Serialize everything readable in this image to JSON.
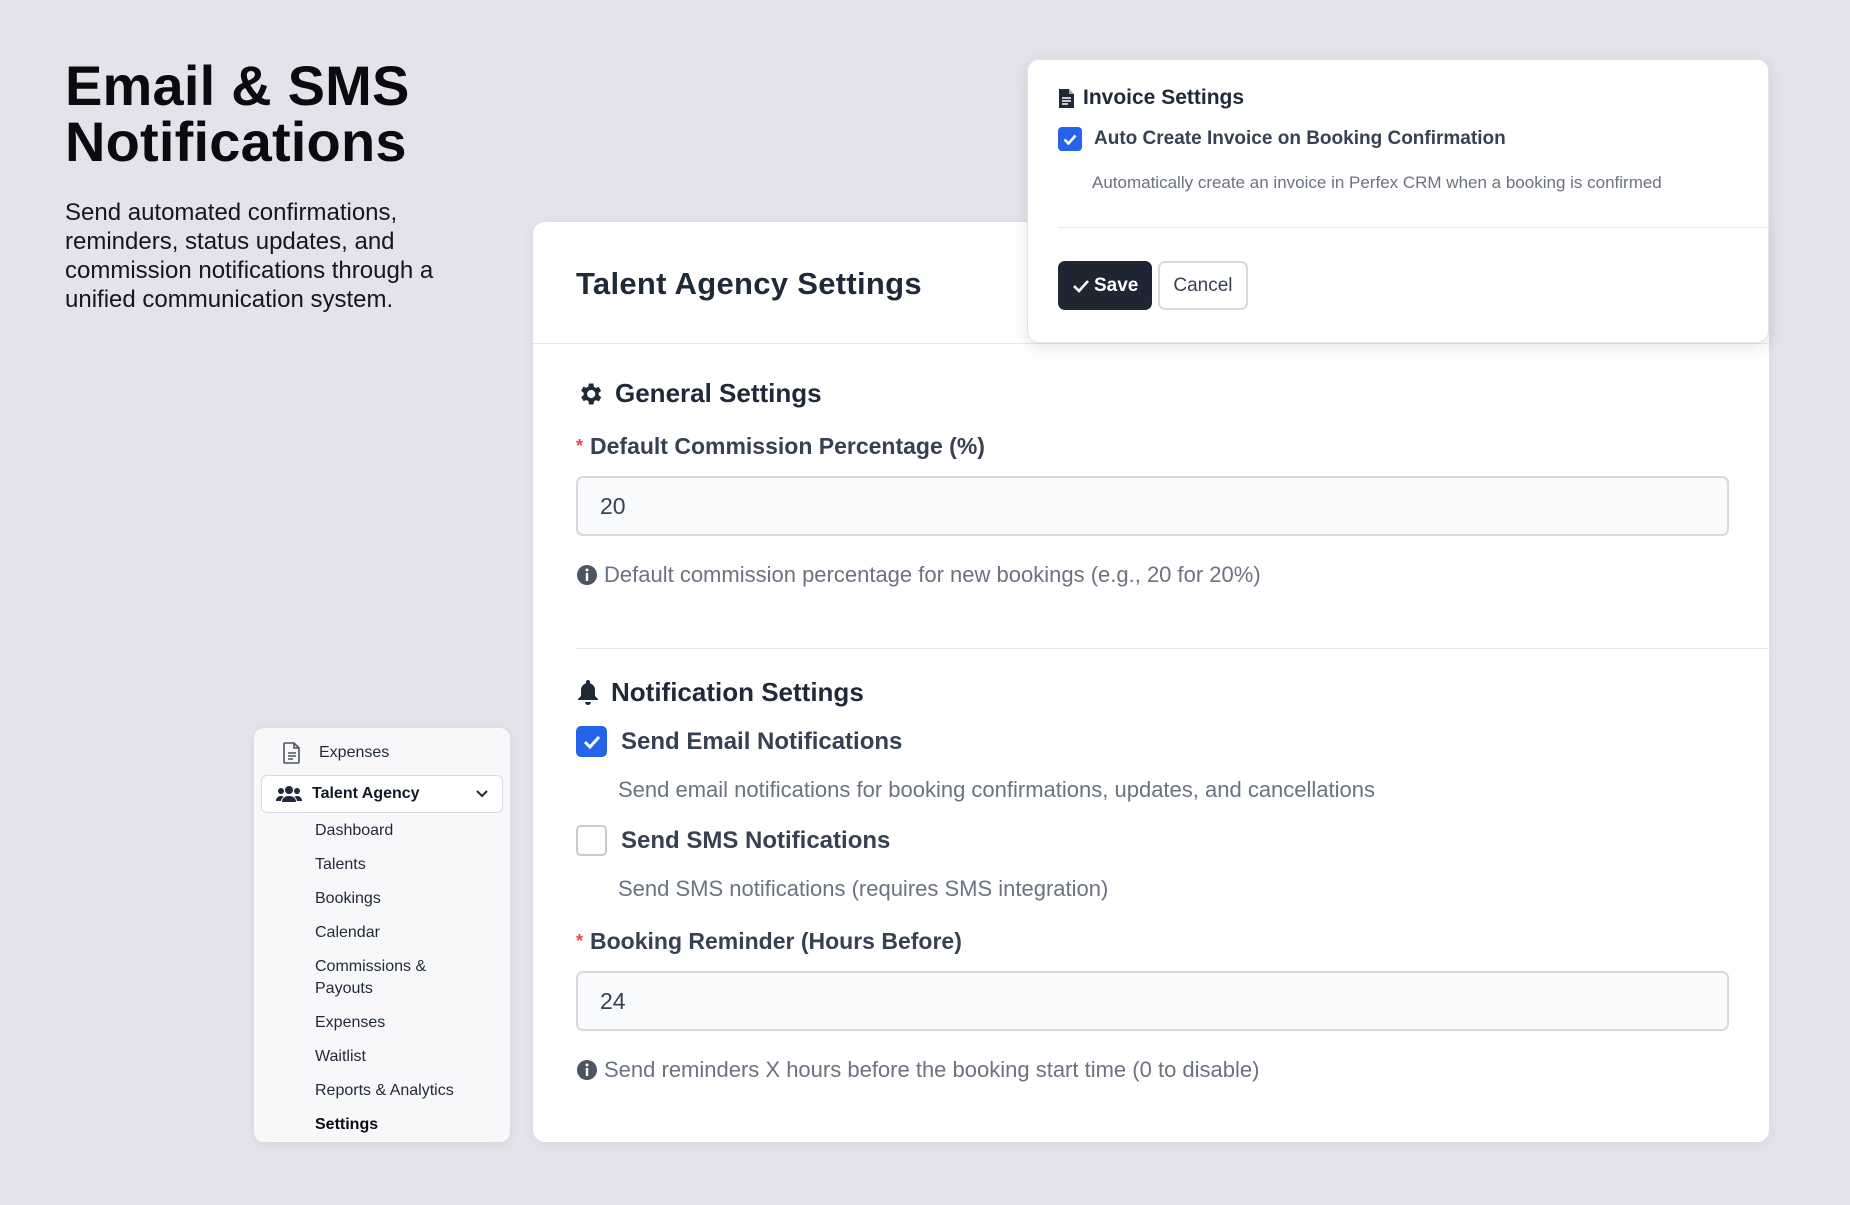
{
  "hero": {
    "title_line1": "Email & SMS",
    "title_line2": "Notifications",
    "description": "Send automated confirmations, reminders, status updates, and commission notifications through a unified communication system."
  },
  "sidebar": {
    "top_item": "Expenses",
    "active_group": "Talent Agency",
    "sub_items": [
      "Dashboard",
      "Talents",
      "Bookings",
      "Calendar",
      "Commissions & Payouts",
      "Expenses",
      "Waitlist",
      "Reports & Analytics",
      "Settings"
    ],
    "active_sub_item": "Settings"
  },
  "main": {
    "title": "Talent Agency Settings",
    "general": {
      "title": "General Settings",
      "commission_label": "Default Commission Percentage (%)",
      "commission_value": "20",
      "commission_hint": "Default commission percentage for new bookings (e.g., 20 for 20%)"
    },
    "notifications": {
      "title": "Notification Settings",
      "email_label": "Send Email Notifications",
      "email_checked": true,
      "email_desc": "Send email notifications for booking confirmations, updates, and cancellations",
      "sms_label": "Send SMS Notifications",
      "sms_checked": false,
      "sms_desc": "Send SMS notifications (requires SMS integration)",
      "reminder_label": "Booking Reminder (Hours Before)",
      "reminder_value": "24",
      "reminder_hint": "Send reminders X hours before the booking start time (0 to disable)"
    }
  },
  "invoice": {
    "title": "Invoice Settings",
    "auto_label": "Auto Create Invoice on Booking Confirmation",
    "auto_checked": true,
    "auto_desc": "Automatically create an invoice in Perfex CRM when a booking is confirmed",
    "save_label": "Save",
    "cancel_label": "Cancel"
  },
  "colors": {
    "accent": "#2563eb",
    "dark_button": "#1e2533",
    "required": "#ef4444",
    "background": "#e3e4eb"
  }
}
